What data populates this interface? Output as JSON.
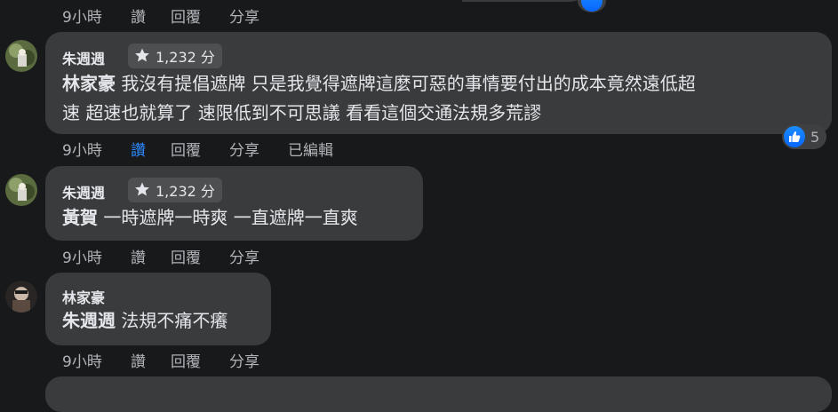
{
  "colors": {
    "background": "#18191a",
    "bubble": "#3a3b3c",
    "text": "#e4e6eb",
    "muted": "#b0b3b8",
    "like_blue": "#2d88ff"
  },
  "top_actions": {
    "time": "9小時",
    "like": "讚",
    "reply": "回覆",
    "share": "分享"
  },
  "comments": [
    {
      "author": "朱週週",
      "badge": "1,232 分",
      "mention": "林家豪",
      "line1": "我沒有提倡遮牌 只是我覺得遮牌這麼可惡的事情要付出的成本竟然遠低超",
      "line2": "速 超速也就算了 速限低到不可思議 看看這個交通法規多荒謬",
      "reaction_count": "5",
      "actions": {
        "time": "9小時",
        "like": "讚",
        "reply": "回覆",
        "share": "分享",
        "edited": "已編輯"
      }
    },
    {
      "author": "朱週週",
      "badge": "1,232 分",
      "mention": "黃賀",
      "body": "一時遮牌一時爽 一直遮牌一直爽",
      "actions": {
        "time": "9小時",
        "like": "讚",
        "reply": "回覆",
        "share": "分享"
      }
    },
    {
      "author": "林家豪",
      "mention": "朱週週",
      "body": "法規不痛不癢",
      "actions": {
        "time": "9小時",
        "like": "讚",
        "reply": "回覆",
        "share": "分享"
      }
    }
  ]
}
